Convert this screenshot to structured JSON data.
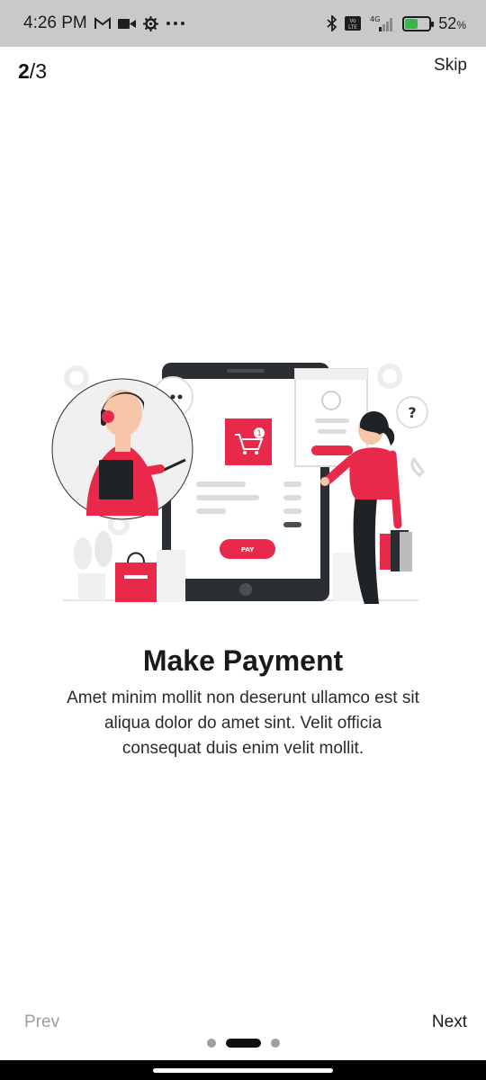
{
  "status_bar": {
    "time": "4:26 PM",
    "left_icons": [
      "gmail-icon",
      "video-icon",
      "settings-icon",
      "more-icon"
    ],
    "right_icons": [
      "bluetooth-icon",
      "volte-icon",
      "signal-icon",
      "battery-icon"
    ],
    "network": "4G",
    "battery_percent": "52",
    "battery_unit": "%",
    "battery_level": 0.52
  },
  "header": {
    "step_current": "2",
    "step_separator": "/",
    "step_total": "3",
    "skip_label": "Skip"
  },
  "illustration": {
    "icon": "online-payment-illustration",
    "pay_button_label": "PAY",
    "cart_badge": "1",
    "accent_color": "#e8294a"
  },
  "content": {
    "title": "Make Payment",
    "description": "Amet minim mollit non deserunt ullamco est sit aliqua dolor do amet sint. Velit officia consequat duis enim velit mollit."
  },
  "footer": {
    "prev_label": "Prev",
    "next_label": "Next",
    "page_count": 3,
    "active_page": 2
  }
}
